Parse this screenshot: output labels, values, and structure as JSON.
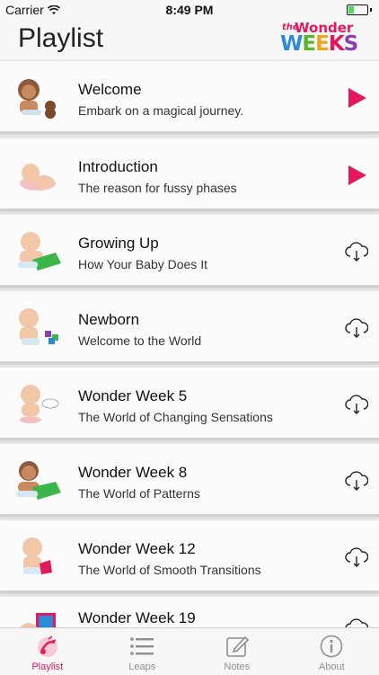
{
  "status_bar": {
    "carrier": "Carrier",
    "time": "8:49 PM"
  },
  "header": {
    "title": "Playlist",
    "logo_small": "the",
    "logo_top": "Wonder",
    "logo_bottom": "WEEKS"
  },
  "playlist": [
    {
      "title": "Welcome",
      "subtitle": "Embark on a magical journey.",
      "action": "play-icon"
    },
    {
      "title": "Introduction",
      "subtitle": "The reason for fussy phases",
      "action": "play-icon"
    },
    {
      "title": "Growing Up",
      "subtitle": "How Your Baby Does It",
      "action": "cloud-download-icon"
    },
    {
      "title": "Newborn",
      "subtitle": "Welcome to the World",
      "action": "cloud-download-icon"
    },
    {
      "title": "Wonder Week 5",
      "subtitle": "The World of Changing Sensations",
      "action": "cloud-download-icon"
    },
    {
      "title": "Wonder Week 8",
      "subtitle": "The World of Patterns",
      "action": "cloud-download-icon"
    },
    {
      "title": "Wonder Week 12",
      "subtitle": "The World of Smooth Transitions",
      "action": "cloud-download-icon"
    },
    {
      "title": "Wonder Week 19",
      "subtitle": "",
      "action": "cloud-download-icon"
    }
  ],
  "tabs": [
    {
      "label": "Playlist",
      "icon": "playlist-icon",
      "active": true
    },
    {
      "label": "Leaps",
      "icon": "list-icon",
      "active": false
    },
    {
      "label": "Notes",
      "icon": "edit-icon",
      "active": false
    },
    {
      "label": "About",
      "icon": "info-icon",
      "active": false
    }
  ],
  "colors": {
    "accent": "#e3195f",
    "inactive": "#8e8e93",
    "battery": "#4cd964"
  }
}
